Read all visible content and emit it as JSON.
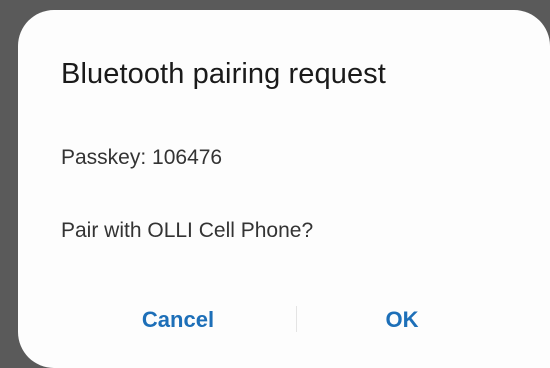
{
  "dialog": {
    "title": "Bluetooth pairing request",
    "passkey_text": "Passkey: 106476",
    "question": "Pair with OLLI Cell Phone?",
    "cancel_label": "Cancel",
    "ok_label": "OK"
  },
  "colors": {
    "scrim": "#5a5a5a",
    "dialog_background": "#fdfdfd",
    "accent": "#1d6fb8",
    "title_text": "#1a1a1a",
    "body_text": "#333333"
  }
}
